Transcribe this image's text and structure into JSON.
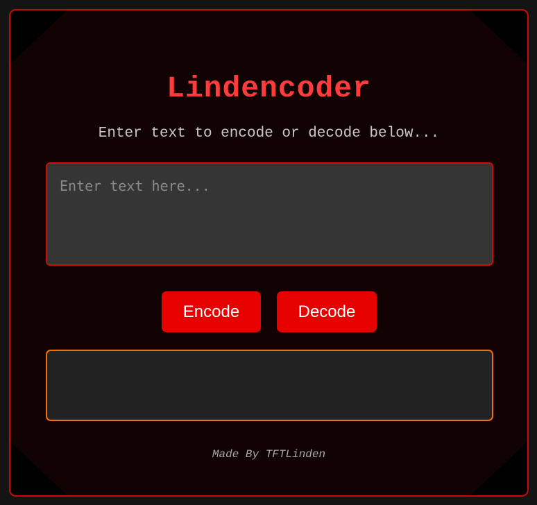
{
  "app": {
    "title": "Lindencoder",
    "subtitle": "Enter text to encode or decode below..."
  },
  "input": {
    "value": "",
    "placeholder": "Enter text here..."
  },
  "buttons": {
    "encode_label": "Encode",
    "decode_label": "Decode"
  },
  "output": {
    "value": ""
  },
  "footer": {
    "credit": "Made By TFTLinden"
  },
  "colors": {
    "accent_red": "#e60000",
    "title_red": "#ff3b3b",
    "frame_border": "#c80a0a",
    "output_border": "#f07010",
    "panel_bg": "#120303"
  }
}
